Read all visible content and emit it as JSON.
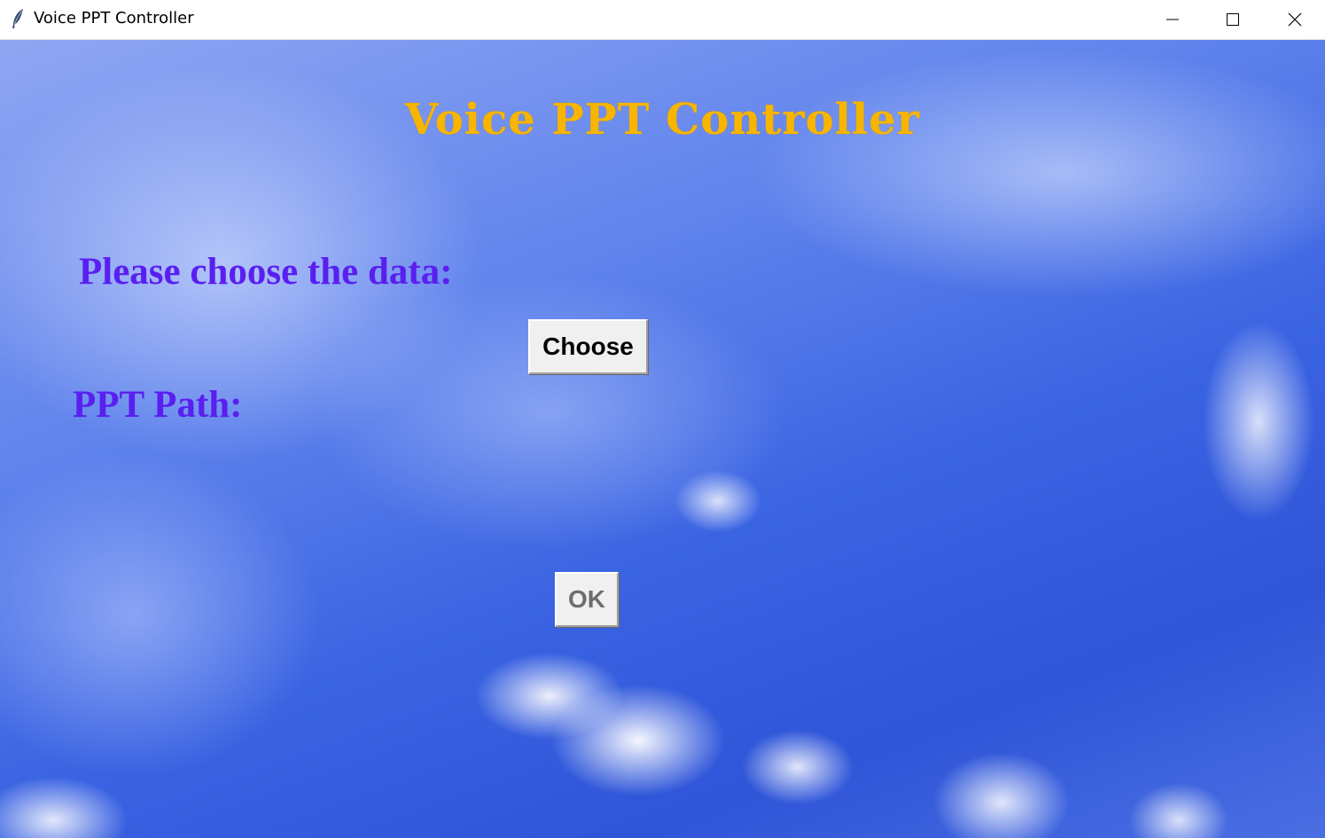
{
  "window": {
    "title": "Voice PPT Controller",
    "icon": "feather-icon",
    "controls": {
      "minimize": "minimize-icon",
      "maximize": "maximize-icon",
      "close": "close-icon"
    }
  },
  "main": {
    "title": "Voice PPT Controller",
    "choose_label": "Please choose the data:",
    "choose_button": "Choose",
    "path_label": "PPT Path:",
    "ok_button": "OK"
  },
  "colors": {
    "title": "#f7b500",
    "labels": "#5a1ff0",
    "button_face": "#f0f0f0",
    "ok_text_disabled": "#6d6d6d",
    "sky": "#3a63e2"
  }
}
